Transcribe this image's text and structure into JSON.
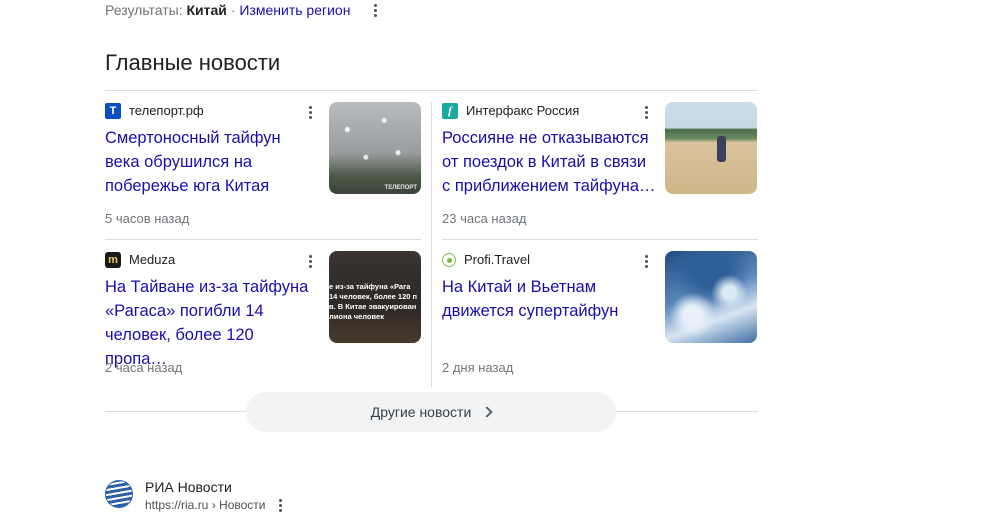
{
  "region": {
    "prefix": "Результаты:",
    "country": "Китай",
    "separator": "·",
    "change_link": "Изменить регион"
  },
  "section_title": "Главные новости",
  "news": [
    {
      "source": "телепорт.рф",
      "favicon_letter": "T",
      "headline": "Смертоносный тайфун века обрушился на побережье юга Китая",
      "time": "5 часов назад",
      "thumb_watermark": "ТЕЛЕПОРТ"
    },
    {
      "source": "Интерфакс Россия",
      "favicon_letter": "f",
      "headline": "Россияне не отказываются от поездок в Китай в связи с приближением тайфуна…",
      "time": "23 часа назад"
    },
    {
      "source": "Meduza",
      "favicon_letter": "m",
      "headline": "На Тайване из-за тайфуна «Рагаса» погибли 14 человек, более 120 пропа…",
      "time": "2 часа назад",
      "thumb_overlay": [
        "е из-за тайфуна «Рага",
        "14 человек, более 120 п",
        "в. В Китае эвакуирован",
        "лиона человек"
      ]
    },
    {
      "source": "Profi.Travel",
      "favicon_letter": "",
      "headline": "На Китай и Вьетнам движется супертайфун",
      "time": "2 дня назад"
    }
  ],
  "more_news_label": "Другие новости",
  "result": {
    "name": "РИА Новости",
    "url": "https://ria.ru › Новости"
  },
  "icons": {
    "more": "more-vert-icon",
    "chevron": "chevron-right-icon",
    "favicons": [
      "teleport-favicon-icon",
      "interfax-favicon-icon",
      "meduza-favicon-icon",
      "profi-travel-favicon-icon"
    ]
  },
  "colors": {
    "link": "#1a0dab",
    "text": "#202124",
    "muted": "#70757a",
    "divider": "#dadce0",
    "button_bg": "#f1f3f4"
  }
}
